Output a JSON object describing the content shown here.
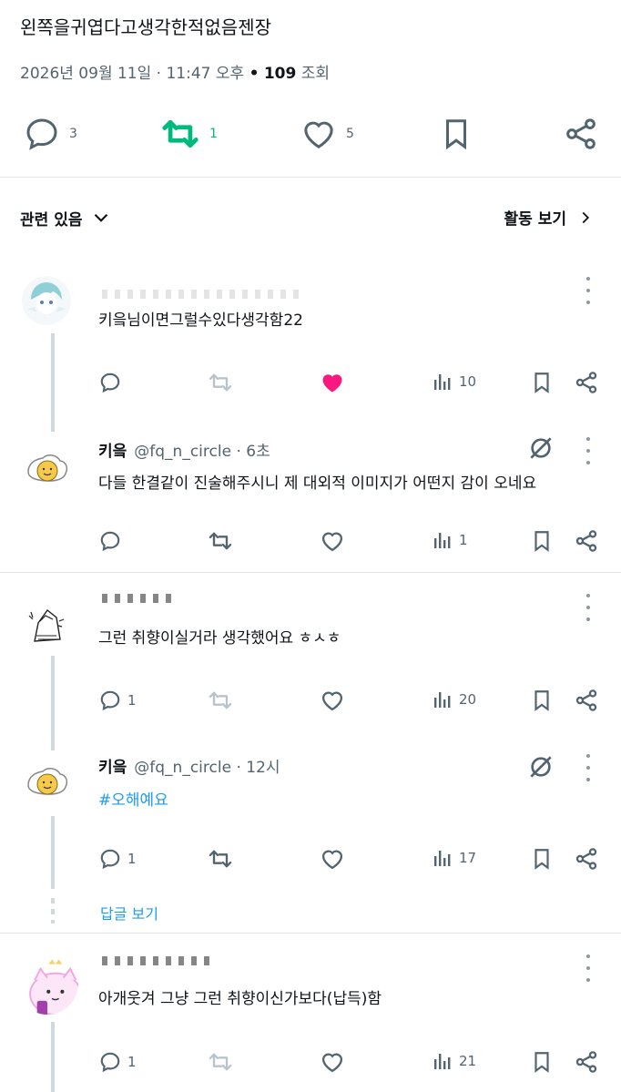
{
  "post": {
    "title": "왼쪽을귀엽다고생각한적없음젠장",
    "date": "2026년 09월 11일 · 11:47 오후",
    "sep": "•",
    "views_count": "109",
    "views_label": "조회",
    "replies": "3",
    "reposts": "1",
    "likes": "5"
  },
  "bar": {
    "related": "관련 있음",
    "activity": "활동 보기"
  },
  "colors": {
    "green": "#00ba7c",
    "pink": "#f91880",
    "link": "#1d9bf0"
  },
  "replies": [
    {
      "text": "키읔님이면그럴수있다생각함22",
      "replies": "",
      "reposts": "",
      "likes": "",
      "views": "10",
      "liked": true
    },
    {
      "name": "키읔",
      "handle": "@fq_n_circle · 6초",
      "text": "다들 한결같이 진술해주시니 제 대외적 이미지가 어떤지 감이 오네요",
      "replies": "",
      "views": "1"
    },
    {
      "text": "그런 취향이실거라 생각했어요 ㅎㅅㅎ",
      "replies": "1",
      "views": "20"
    },
    {
      "name": "키읔",
      "handle": "@fq_n_circle · 12시",
      "text": "#오해예요",
      "replies": "1",
      "views": "17"
    },
    {
      "text": "아개웃겨 그냥 그런 취향이신가보다(납득)함",
      "replies": "1",
      "views": "21"
    }
  ],
  "show_replies": "답글 보기"
}
